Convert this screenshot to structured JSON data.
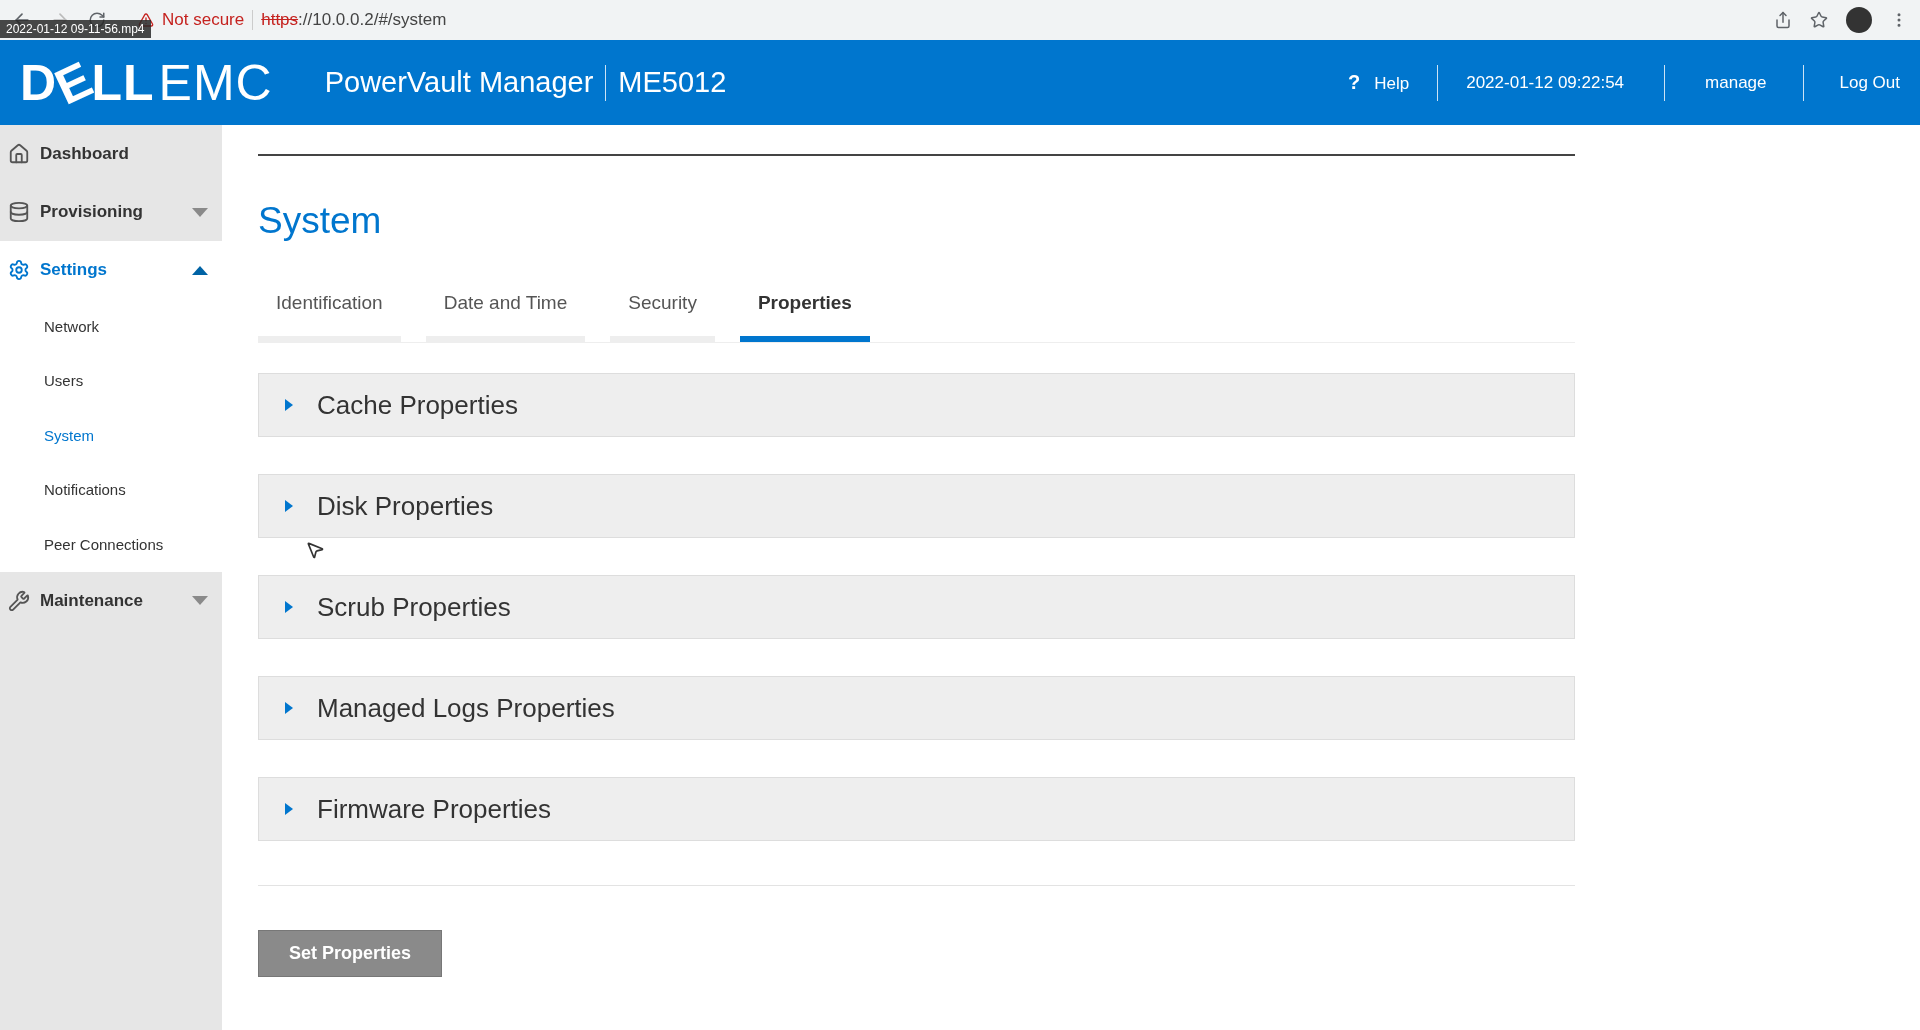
{
  "browser": {
    "security": "Not secure",
    "url_scheme": "https",
    "url_rest": "://10.0.0.2/#/system"
  },
  "video_label": "2022-01-12 09-11-56.mp4",
  "header": {
    "logo_a": "D",
    "logo_e": "E",
    "logo_b": "LL",
    "logo_c": "EMC",
    "product": "PowerVault Manager",
    "model": "ME5012",
    "help": "Help",
    "help_mark": "?",
    "datetime": "2022-01-12 09:22:54",
    "user": "manage",
    "logout": "Log Out"
  },
  "sidebar": {
    "items": [
      {
        "label": "Dashboard",
        "kind": "link",
        "selected": false
      },
      {
        "label": "Provisioning",
        "kind": "group",
        "selected": false,
        "expanded": false
      },
      {
        "label": "Settings",
        "kind": "group",
        "selected": true,
        "expanded": true,
        "children": [
          {
            "label": "Network",
            "selected": false
          },
          {
            "label": "Users",
            "selected": false
          },
          {
            "label": "System",
            "selected": true
          },
          {
            "label": "Notifications",
            "selected": false
          },
          {
            "label": "Peer Connections",
            "selected": false
          }
        ]
      },
      {
        "label": "Maintenance",
        "kind": "group",
        "selected": false,
        "expanded": false
      }
    ]
  },
  "page": {
    "title": "System",
    "tabs": [
      {
        "label": "Identification",
        "selected": false
      },
      {
        "label": "Date and Time",
        "selected": false
      },
      {
        "label": "Security",
        "selected": false
      },
      {
        "label": "Properties",
        "selected": true
      }
    ],
    "sections": [
      {
        "label": "Cache Properties",
        "expanded": false
      },
      {
        "label": "Disk Properties",
        "expanded": false
      },
      {
        "label": "Scrub Properties",
        "expanded": false
      },
      {
        "label": "Managed Logs Properties",
        "expanded": false
      },
      {
        "label": "Firmware Properties",
        "expanded": false
      }
    ],
    "button": "Set Properties"
  }
}
